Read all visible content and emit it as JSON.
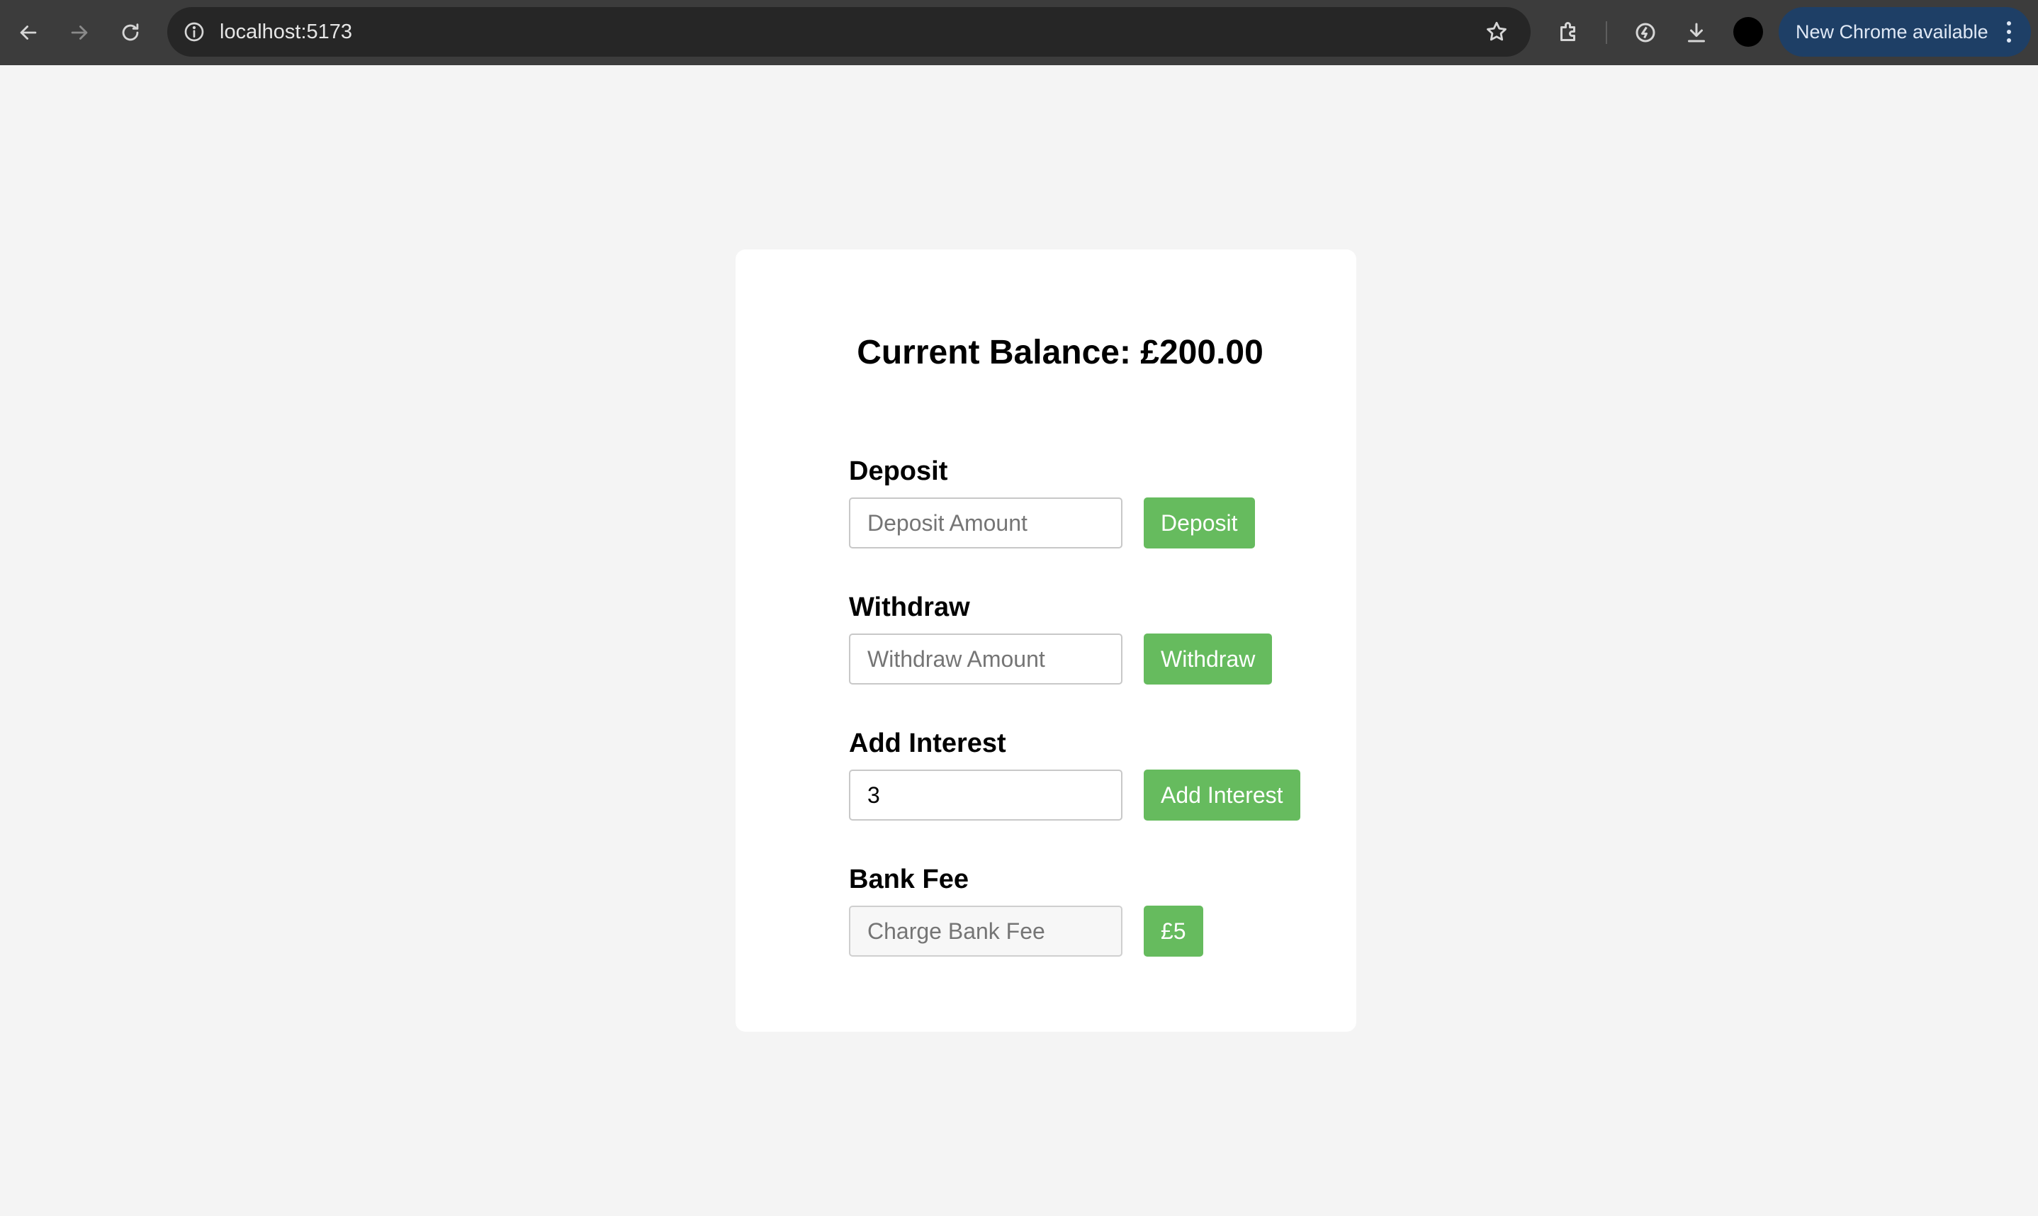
{
  "browser": {
    "url": "localhost:5173",
    "update_label": "New Chrome available"
  },
  "balance": {
    "text": "Current Balance: £200.00"
  },
  "deposit": {
    "heading": "Deposit",
    "placeholder": "Deposit Amount",
    "value": "",
    "button": "Deposit"
  },
  "withdraw": {
    "heading": "Withdraw",
    "placeholder": "Withdraw Amount",
    "value": "",
    "button": "Withdraw"
  },
  "interest": {
    "heading": "Add Interest",
    "placeholder": "",
    "value": "3",
    "button": "Add Interest"
  },
  "fee": {
    "heading": "Bank Fee",
    "placeholder": "Charge Bank Fee",
    "value": "",
    "button": "£5"
  },
  "colors": {
    "accent_green": "#66bb5e",
    "page_bg": "#f4f4f4",
    "chrome_bg": "#3c3c3c",
    "update_pill": "#1e3f66"
  }
}
